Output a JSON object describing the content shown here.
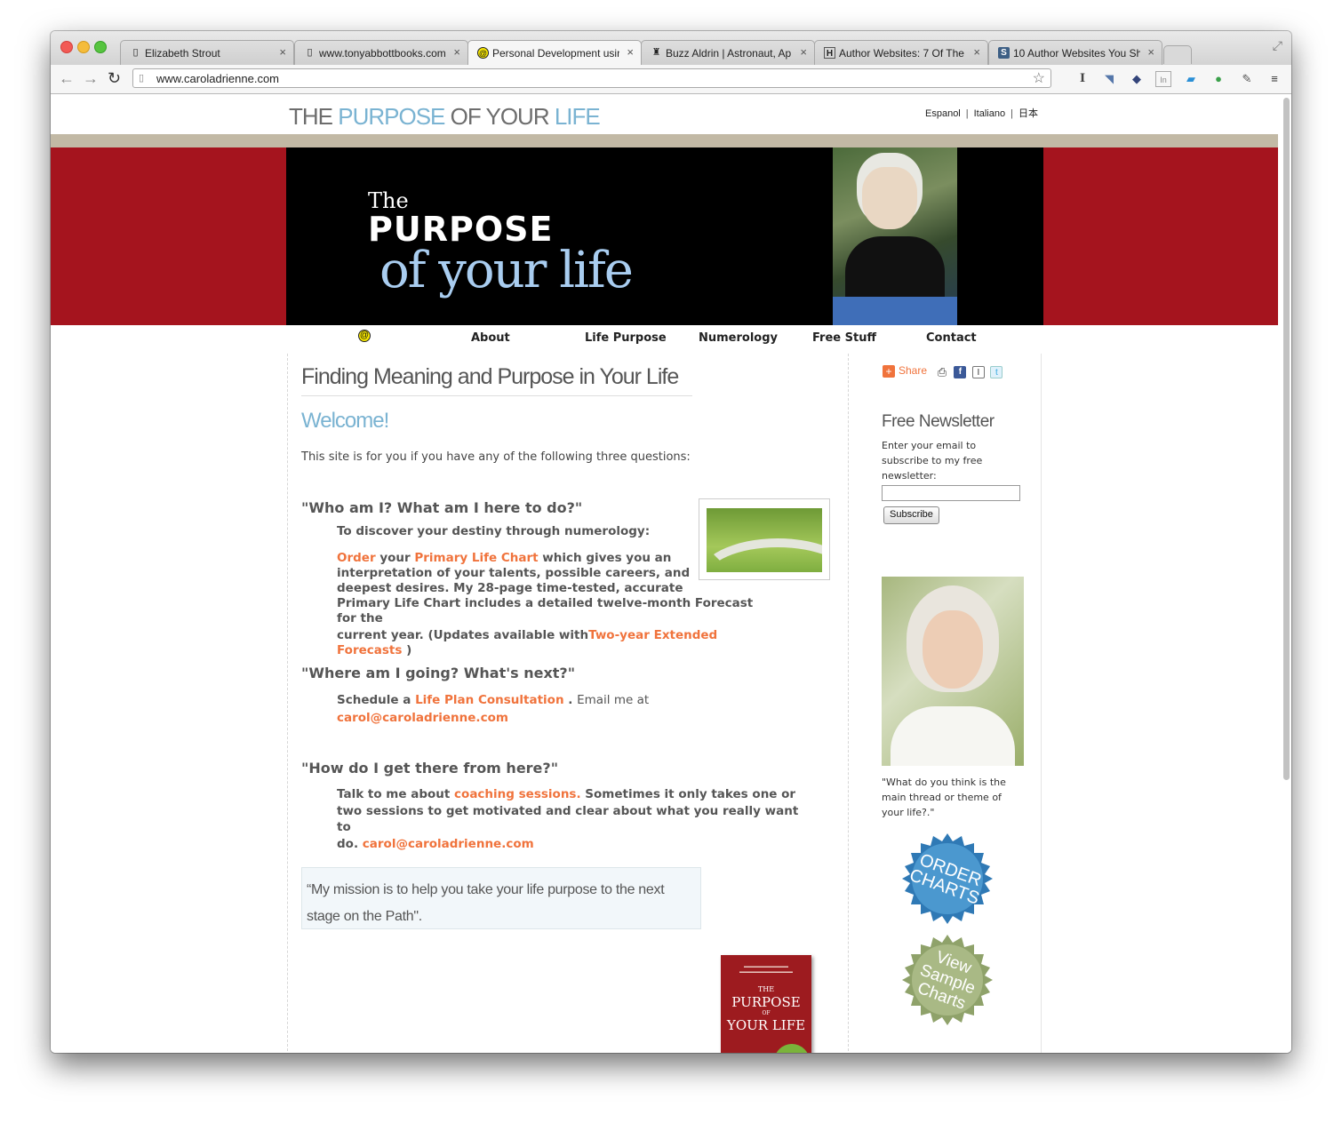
{
  "browser": {
    "tabs": [
      {
        "title": "Elizabeth Strout",
        "icon": "page-icon",
        "active": false
      },
      {
        "title": "www.tonyabbottbooks.com",
        "icon": "page-icon",
        "active": false
      },
      {
        "title": "Personal Development using",
        "icon": "spiral-icon",
        "active": true
      },
      {
        "title": "Buzz Aldrin | Astronaut, Ap",
        "icon": "astronaut-icon",
        "active": false
      },
      {
        "title": "Author Websites: 7 Of The",
        "icon": "h-icon",
        "active": false
      },
      {
        "title": "10 Author Websites You Sh",
        "icon": "s-icon",
        "active": false
      }
    ],
    "tab_close": "×",
    "url": "www.caroladrienne.com"
  },
  "site": {
    "title_parts": [
      "THE ",
      "PURPOSE",
      " OF YOUR ",
      "LIFE"
    ],
    "languages": [
      "Espanol",
      "Italiano",
      "日本"
    ],
    "lang_sep": "|",
    "banner": {
      "the": "The",
      "purpose": "PURPOSE",
      "of_your_life": "of your life"
    },
    "nav": [
      "About",
      "Life Purpose",
      "Numerology",
      "Free Stuff",
      "Contact"
    ]
  },
  "main": {
    "heading": "Finding Meaning and Purpose in Your Life",
    "welcome": "Welcome!",
    "intro": "This site is for you if you have any of the following three questions:",
    "q1": {
      "question": "\"Who am I? What am I here to do?\"",
      "sub": "To discover your destiny through numerology:",
      "order": "Order",
      "your": " your ",
      "chart_link": "Primary Life Chart",
      "line1_rest": " which gives you an",
      "line2": "interpretation of your talents, possible careers, and",
      "line3": "deepest desires.  My 28-page time-tested, accurate",
      "line4": "Primary Life Chart includes a detailed twelve-month Forecast for the",
      "line5": "current year. (Updates available with ",
      "forecast_link": "Two-year Extended Forecasts",
      "close": " )"
    },
    "q2": {
      "question": "\"Where am I going? What's next?\"",
      "schedule": "Schedule a ",
      "consult_link": "Life Plan Consultation",
      "after": " .  ",
      "email_me": "Email me at",
      "email": "carol@caroladrienne.com"
    },
    "q3": {
      "question": "\"How do I get there from here?\"",
      "talk": "Talk to me about ",
      "coaching_link": "coaching sessions.",
      "rest1": " Sometimes it only takes one or",
      "line2": "two sessions to get motivated and clear about what you really want to",
      "line3": "do.   ",
      "email": "carol@caroladrienne.com"
    },
    "mission": "“My mission is to help you take your life purpose to the next stage on the Path\".",
    "book": {
      "title_the": "THE",
      "title_main": "PURPOSE",
      "title_of": "OF",
      "title_end": "YOUR LIFE"
    }
  },
  "sidebar": {
    "share": "Share",
    "newsletter_title": "Free Newsletter",
    "newsletter_text": "Enter your email to subscribe to my free newsletter:",
    "subscribe": "Subscribe",
    "quote": "\"What do you think is the main thread or theme of your life?.\"",
    "order_badge": "ORDER CHARTS",
    "view_badge": "View Sample Charts"
  },
  "colors": {
    "accent_blue": "#7ab3d2",
    "link_orange": "#f0733c",
    "brand_red": "#a5141e"
  }
}
